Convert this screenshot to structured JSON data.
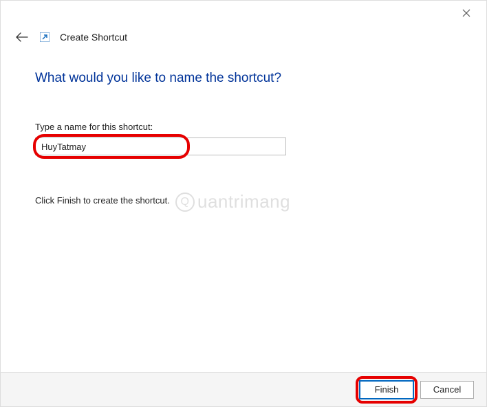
{
  "header": {
    "title": "Create Shortcut"
  },
  "main": {
    "heading": "What would you like to name the shortcut?",
    "field_label": "Type a name for this shortcut:",
    "input_value": "HuyTatmay",
    "instruction": "Click Finish to create the shortcut."
  },
  "footer": {
    "finish_label": "Finish",
    "cancel_label": "Cancel"
  },
  "watermark": {
    "text": "uantrimang"
  }
}
